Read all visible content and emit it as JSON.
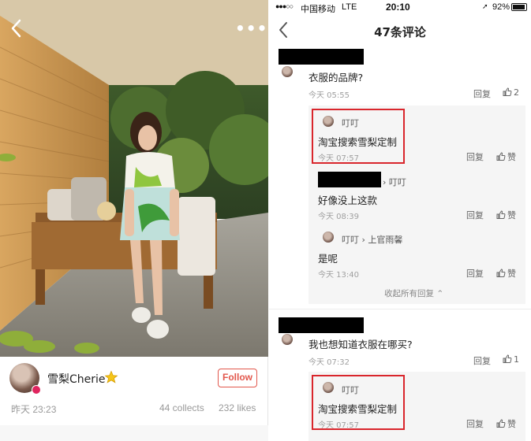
{
  "left_post": {
    "author_name": "雪梨Cherie",
    "follow_label": "Follow",
    "post_time": "昨天 23:23",
    "collects": "44 collects",
    "likes": "232 likes",
    "more_label": "•••"
  },
  "right_comments": {
    "status": {
      "signal": "●●●○○",
      "carrier": "中国移动",
      "network": "LTE",
      "time": "20:10",
      "location_icon": "➚",
      "battery_pct": "92%",
      "battery_level": 0.92
    },
    "header_title": "47条评论",
    "comments": [
      {
        "text": "衣服的品牌?",
        "time": "今天 05:55",
        "reply_label": "回复",
        "like_count": "2",
        "replies": [
          {
            "name": "叮叮",
            "text": "淘宝搜索雪梨定制",
            "time": "今天 07:57",
            "reply_label": "回复",
            "like_label": "赞"
          },
          {
            "name": "叮叮",
            "text": "好像没上这款",
            "time": "今天 08:39",
            "reply_label": "回复",
            "like_label": "赞"
          },
          {
            "name": "叮叮",
            "reply_to": "上官雨馨",
            "text": "是呢",
            "time": "今天 13:40",
            "reply_label": "回复",
            "like_label": "赞"
          }
        ],
        "collapse_label": "收起所有回复"
      },
      {
        "text": "我也想知道衣服在哪买?",
        "time": "今天 07:32",
        "reply_label": "回复",
        "like_count": "1",
        "replies": [
          {
            "name": "叮叮",
            "text": "淘宝搜索雪梨定制",
            "time": "今天 07:57",
            "reply_label": "回复",
            "like_label": "赞"
          }
        ]
      }
    ]
  },
  "colors": {
    "follow_red": "#e2574c",
    "highlight_red": "#d9262c",
    "reply_bg": "#f5f5f5"
  },
  "icons": [
    "back-arrow-icon",
    "more-icon",
    "star-icon",
    "thumbs-up-icon",
    "location-icon",
    "battery-icon",
    "chevron-up-icon"
  ]
}
